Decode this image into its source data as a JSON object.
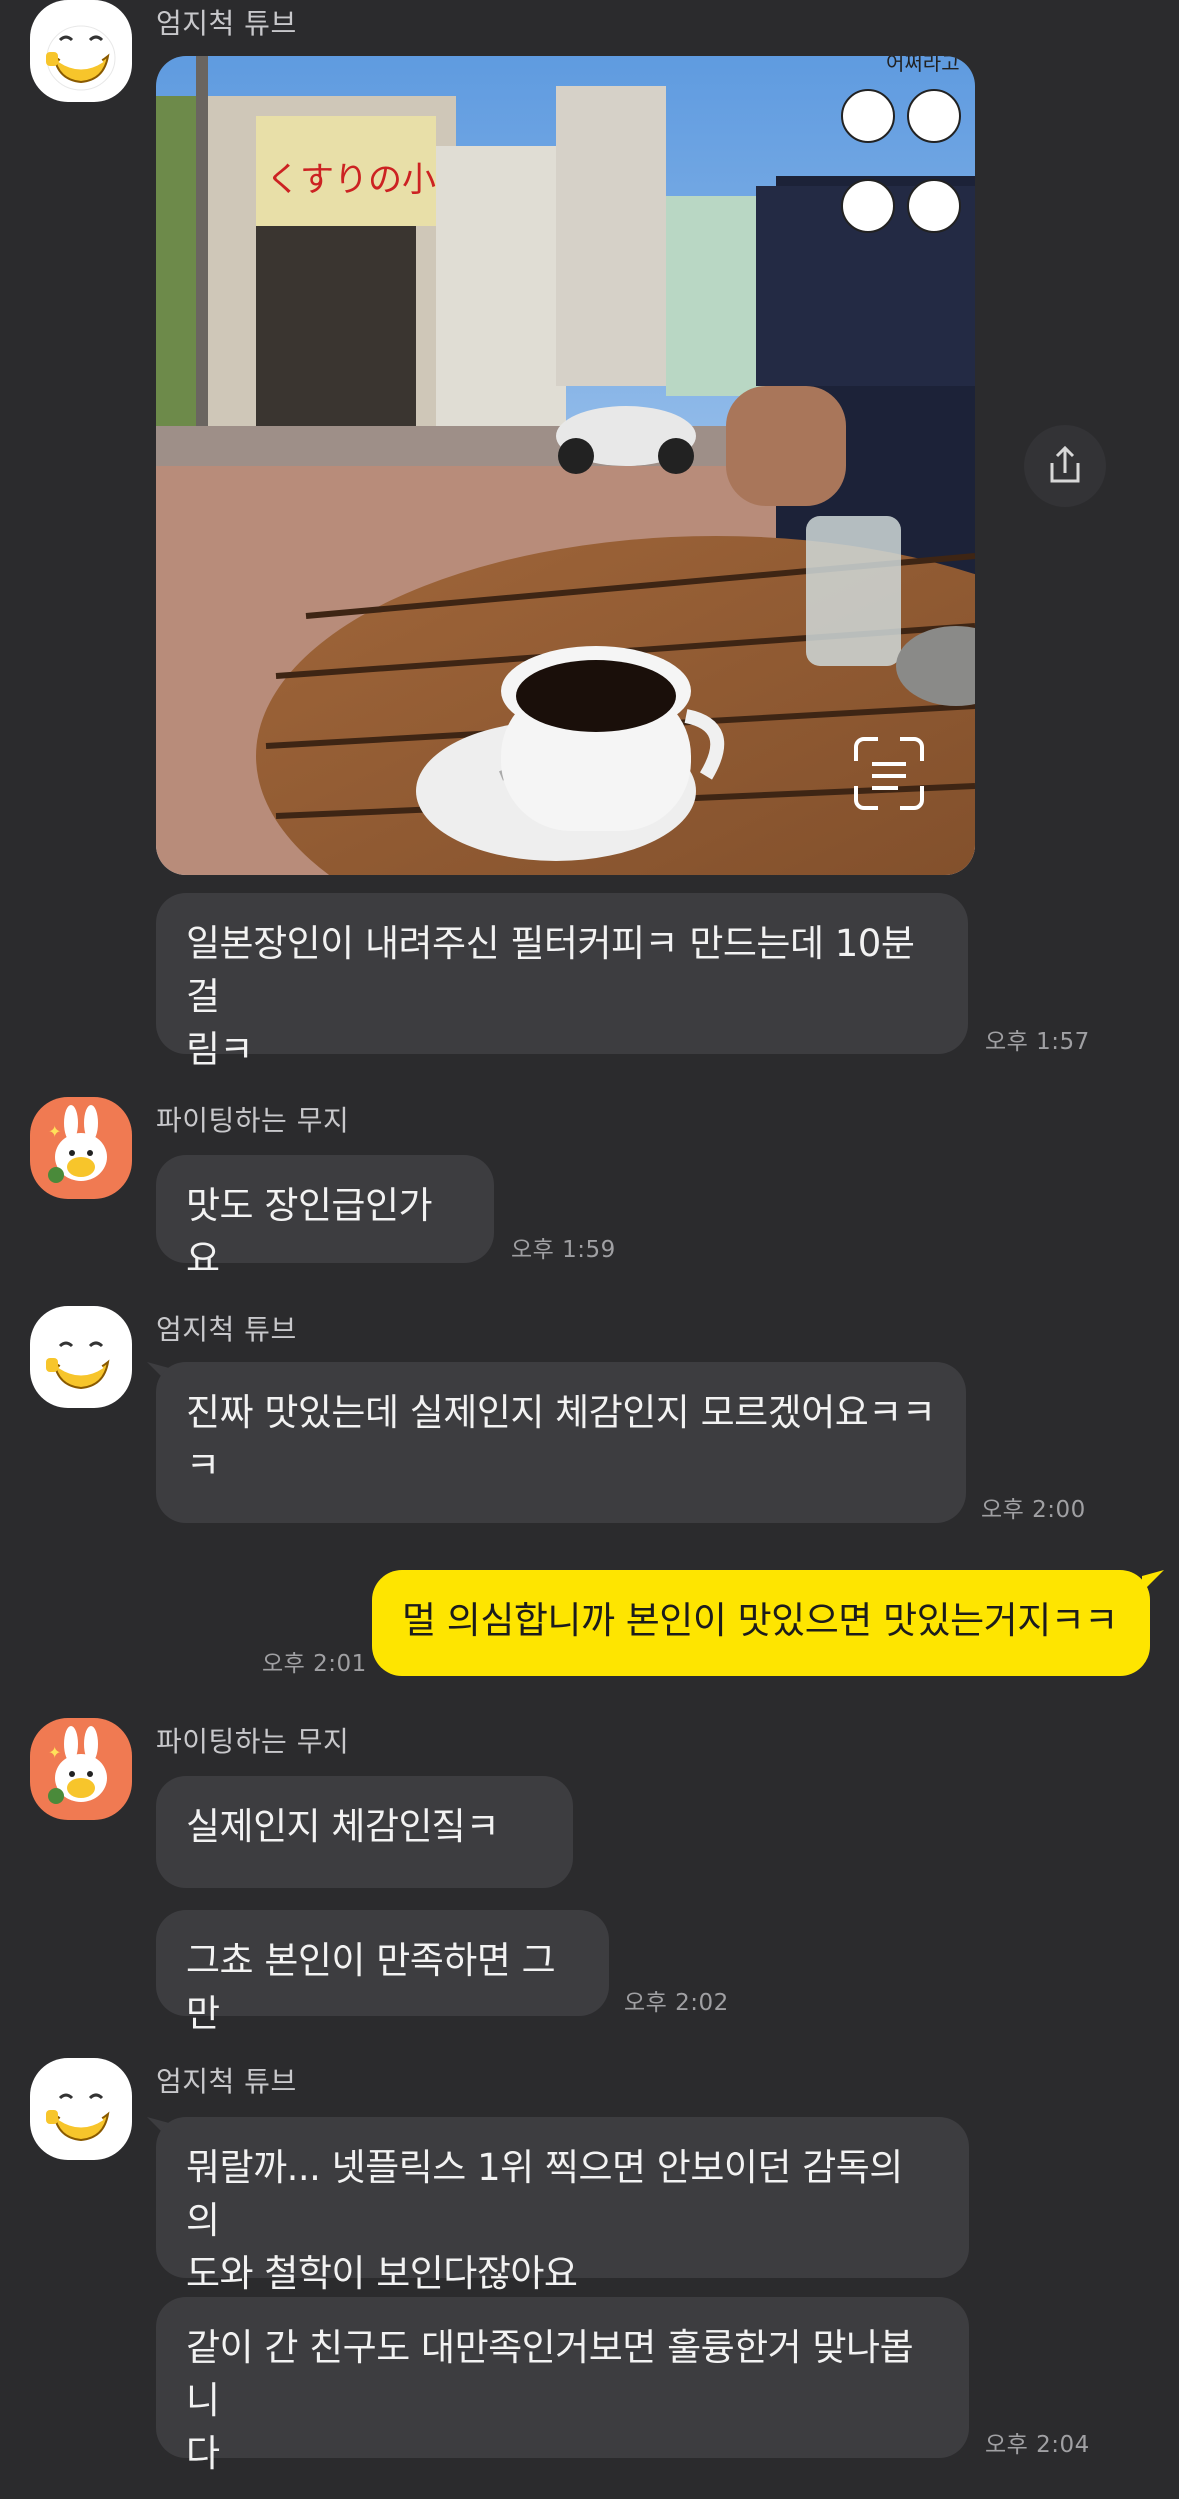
{
  "chat": {
    "messages": [
      {
        "sender": "엄지척 튜브",
        "photo": {
          "sticker_text": "어쩌라고"
        },
        "text": "일본장인이 내려주신 필터커피ㅋ 만드는데 10분걸림ㅋ",
        "line1": "일본장인이 내려주신 필터커피ㅋ 만드는데 10분걸",
        "line2": "림ㅋ",
        "time": "오후 1:57"
      },
      {
        "sender": "파이팅하는 무지",
        "text": "맛도 장인급인가요",
        "time": "오후 1:59"
      },
      {
        "sender": "엄지척 튜브",
        "text": "진짜 맛있는데 실제인지 체감인지 모르겠어요ㅋㅋㅋ",
        "line1": "진짜 맛있는데 실제인지 체감인지 모르겠어요ㅋㅋ",
        "line2": "ㅋ",
        "time": "오후 2:00"
      },
      {
        "sender": "me",
        "text": "멀 의심합니까 본인이 맛있으면 맛있는거지ㅋㅋ",
        "time": "오후 2:01"
      },
      {
        "sender": "파이팅하는 무지",
        "texts": [
          "실제인지 체감인짘ㅋ",
          "그쵸 본인이 만족하면 그만"
        ],
        "time": "오후 2:02"
      },
      {
        "sender": "엄지척 튜브",
        "texts": [
          {
            "line1": "뭐랄까... 넷플릭스 1위 찍으면 안보이던 감독의 의",
            "line2": "도와 철학이 보인다잖아요"
          },
          {
            "line1": "같이 간 친구도 대만족인거보면 훌륭한거 맞나봅니",
            "line2": "다"
          }
        ],
        "time": "오후 2:04"
      }
    ]
  },
  "colors": {
    "background": "#2b2b2d",
    "bubble_other": "#3d3d40",
    "bubble_mine": "#fee500"
  },
  "icons": {
    "share": "share-icon",
    "text_scan": "text-scan-icon"
  }
}
